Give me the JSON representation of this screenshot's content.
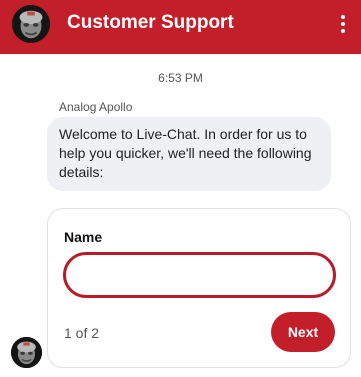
{
  "header": {
    "title": "Customer Support",
    "background_color": "#c21f2a",
    "avatar_icon": "agent-avatar",
    "menu_icon": "more-vertical-icon"
  },
  "chat": {
    "timestamp": "6:53 PM",
    "sender_name": "Analog Apollo",
    "message_text": "Welcome to Live-Chat. In order for us to help you quicker, we'll need the following details:"
  },
  "form": {
    "field_label": "Name",
    "name_value": "",
    "name_placeholder": "",
    "step_text": "1 of 2",
    "next_label": "Next",
    "accent_color": "#b71c2b"
  }
}
